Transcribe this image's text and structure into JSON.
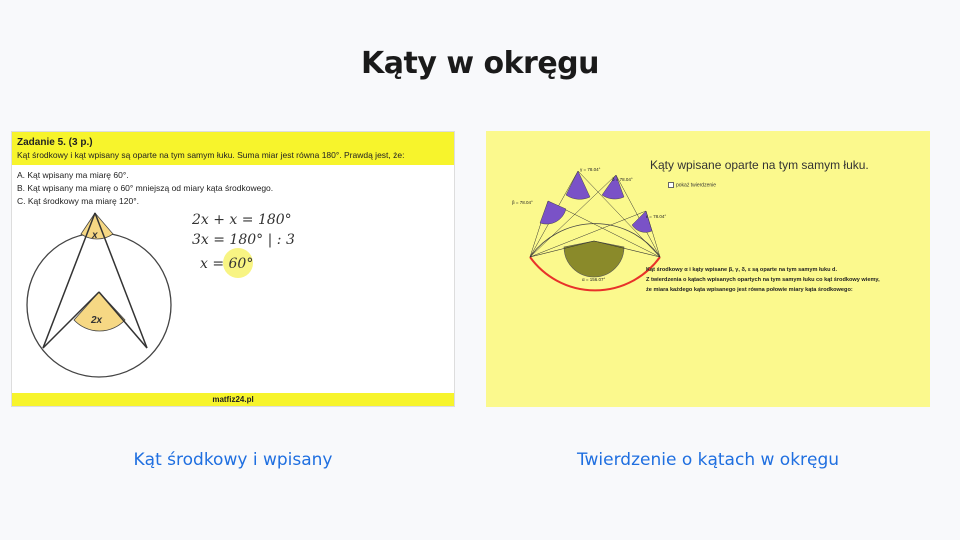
{
  "title": "Kąty w okręgu",
  "left": {
    "caption": "Kąt środkowy i wpisany",
    "task_title": "Zadanie 5. (3 p.)",
    "task_text": "Kąt środkowy i kąt wpisany są oparte na tym samym łuku. Suma miar jest równa 180°. Prawdą jest, że:",
    "options": [
      "A. Kąt wpisany ma miarę 60°.",
      "B. Kąt wpisany ma miarę o 60° mniejszą od miary kąta środkowego.",
      "C. Kąt środkowy ma miarę 120°."
    ],
    "label_x": "x",
    "label_2x": "2x",
    "hand_line1": "2x + x = 180°",
    "hand_line2": "3x = 180°  | : 3",
    "hand_line3": "x = 60°",
    "footer": "matfiz24.pl"
  },
  "right": {
    "caption": "Twierdzenie o kątach w okręgu",
    "geo_title": "Kąty wpisane oparte na tym samym łuku.",
    "checkbox_label": "pokaż twierdzenie",
    "angle_labels": {
      "beta": "β = 78.04°",
      "gamma": "γ = 78.04°",
      "delta": "δ = 78.04°",
      "epsilon": "ε = 78.04°",
      "alpha": "α = 156.07°"
    },
    "text_lines": [
      "Kąt środkowy α i kąty wpisane β, γ, δ, ε są oparte na tym samym łuku d.",
      "Z twierdzenia o kątach wpisanych opartych na tym samym łuku co kąt środkowy wiemy,",
      "że miara każdego kąta wpisanego jest równa połowie miary kąta środkowego:"
    ]
  },
  "colors": {
    "yellow": "#f7f42c",
    "link": "#1f6fe0",
    "geo_bg": "#fbf98d",
    "purple": "#7a52c7",
    "olive": "#8a8a2a",
    "arc_red": "#e8322a"
  }
}
